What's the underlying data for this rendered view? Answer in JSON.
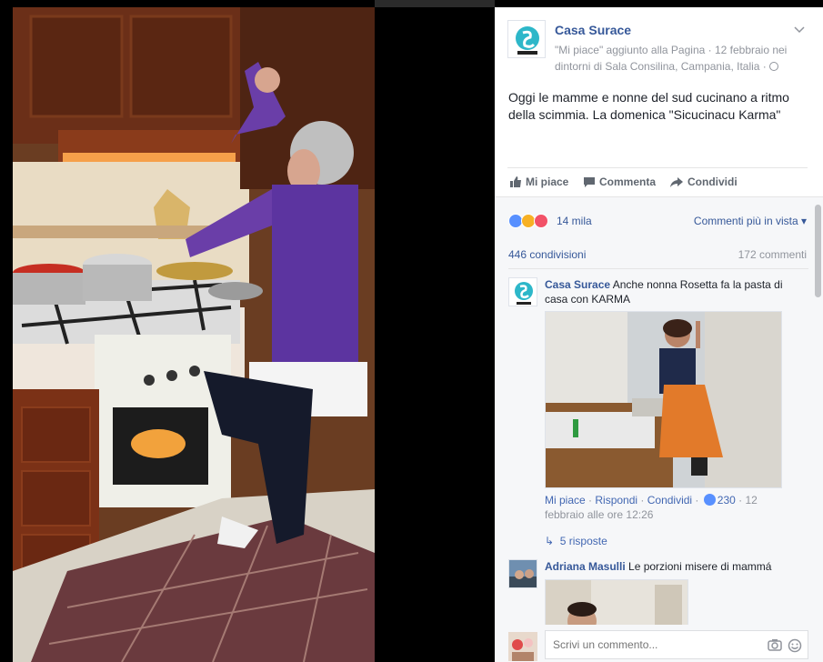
{
  "page": {
    "name": "Casa Surace",
    "meta_line": "\"Mi piace\" aggiunto alla Pagina · 12 febbraio nei dintorni di Sala Consilina, Campania, Italia ·",
    "post_text": "Oggi le mamme e nonne del sud cucinano a ritmo della scimmia. La domenica \"Sicucinacu Karma\""
  },
  "actions": {
    "like": "Mi piace",
    "comment": "Commenta",
    "share": "Condividi"
  },
  "reactions": {
    "count": "14 mila",
    "sort": "Commenti più in vista ▾",
    "colors": {
      "like": "#5890ff",
      "haha": "#f7b125",
      "love": "#f25268"
    }
  },
  "stats": {
    "shares": "446 condivisioni",
    "comments": "172 commenti"
  },
  "comments": [
    {
      "author": "Casa Surace",
      "text": "Anche nonna Rosetta fa la pasta di casa con KARMA",
      "meta_like": "Mi piace",
      "meta_reply": "Rispondi",
      "meta_share": "Condividi",
      "likes": "230",
      "time": "12 febbraio alle ore 12:26",
      "replies": "5 risposte"
    },
    {
      "author": "Adriana Masulli",
      "text": "Le porzioni misere di mammá"
    }
  ],
  "composer": {
    "placeholder": "Scrivi un commento..."
  }
}
